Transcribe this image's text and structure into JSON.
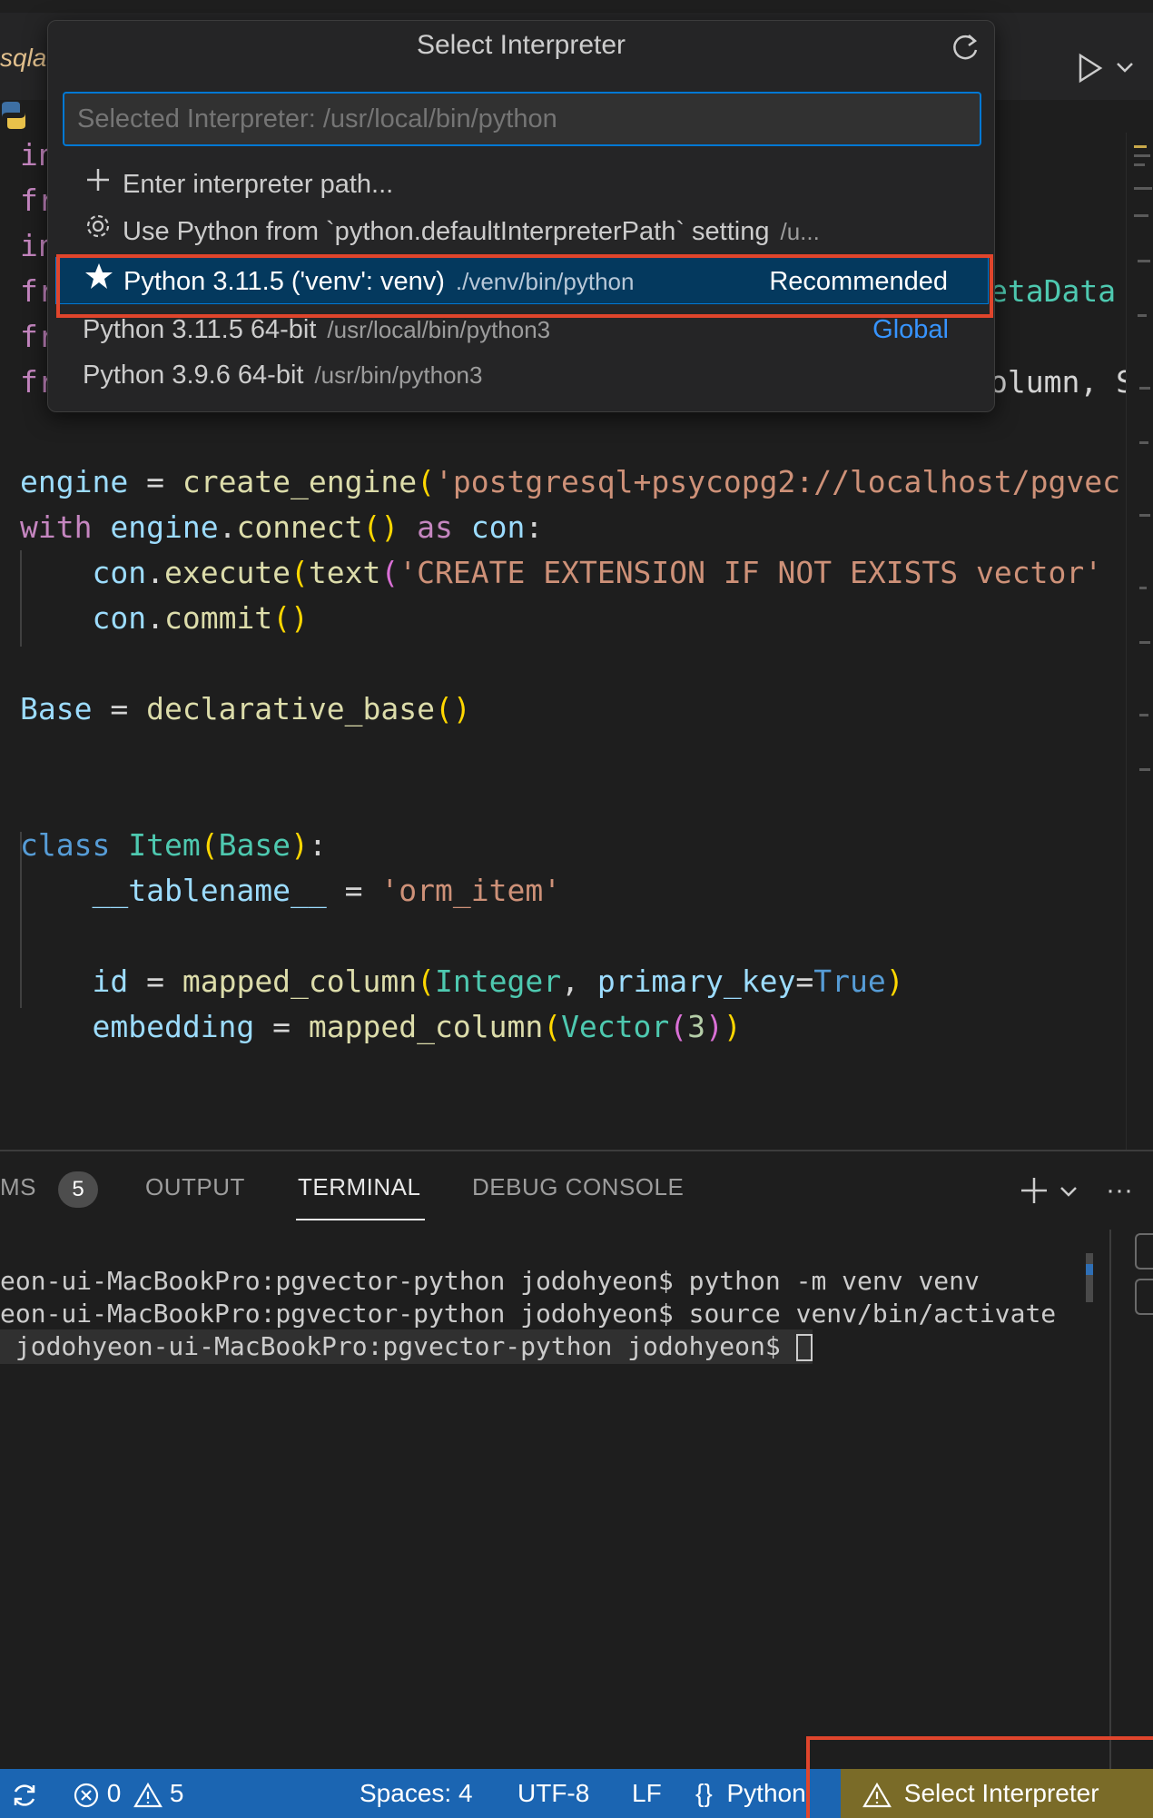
{
  "editor_tab": {
    "file_label": "sqla"
  },
  "quick_pick": {
    "title": "Select Interpreter",
    "placeholder": "Selected Interpreter: /usr/local/bin/python",
    "items": [
      {
        "icon": "plus-icon",
        "label": "Enter interpreter path...",
        "description": "",
        "tag": ""
      },
      {
        "icon": "gear-icon",
        "label": "Use Python from `python.defaultInterpreterPath` setting",
        "description": "/u...",
        "tag": ""
      },
      {
        "icon": "star-icon",
        "label": "Python 3.11.5 ('venv': venv)",
        "description": "./venv/bin/python",
        "tag": "Recommended",
        "selected": true
      },
      {
        "icon": "",
        "label": "Python 3.11.5 64-bit",
        "description": "/usr/local/bin/python3",
        "tag": "Global"
      },
      {
        "icon": "",
        "label": "Python 3.9.6 64-bit",
        "description": "/usr/bin/python3",
        "tag": ""
      }
    ]
  },
  "code": {
    "hidden_prefixes": [
      "in",
      "fr",
      "in",
      "fr",
      "fr",
      "fr"
    ],
    "peeking_right": [
      "etaData",
      "olumn, S"
    ],
    "line8": {
      "a": "engine",
      "b": " = ",
      "c": "create_engine",
      "d": "(",
      "e": "'postgresql+psycopg2://localhost/pgvec"
    },
    "line9": {
      "a": "with",
      "b": " ",
      "c": "engine",
      "d": ".",
      "e": "connect",
      "f": "()",
      "g": " ",
      "h": "as",
      "i": " ",
      "j": "con",
      "k": ":"
    },
    "line10": {
      "a": "    ",
      "b": "con",
      "c": ".",
      "d": "execute",
      "e": "(",
      "f": "text",
      "g": "(",
      "h": "'CREATE EXTENSION IF NOT EXISTS vector'"
    },
    "line11": {
      "a": "    ",
      "b": "con",
      "c": ".",
      "d": "commit",
      "e": "()"
    },
    "line13": {
      "a": "Base",
      "b": " = ",
      "c": "declarative_base",
      "d": "()"
    },
    "line16": {
      "a": "class",
      "b": " ",
      "c": "Item",
      "d": "(",
      "e": "Base",
      "f": ")",
      "g": ":"
    },
    "line17": {
      "a": "    ",
      "b": "__tablename__",
      "c": " = ",
      "d": "'orm_item'"
    },
    "line19": {
      "a": "    ",
      "b": "id",
      "c": " = ",
      "d": "mapped_column",
      "e": "(",
      "f": "Integer",
      "g": ", ",
      "h": "primary_key",
      "i": "=",
      "j": "True",
      "k": ")"
    },
    "line20": {
      "a": "    ",
      "b": "embedding",
      "c": " = ",
      "d": "mapped_column",
      "e": "(",
      "f": "Vector",
      "g": "(",
      "h": "3",
      "i": ")",
      "j": ")"
    }
  },
  "panel": {
    "tabs": {
      "problems": "MS",
      "problems_count": "5",
      "output": "OUTPUT",
      "terminal": "TERMINAL",
      "debug": "DEBUG CONSOLE"
    },
    "more": "···",
    "terminal_lines": [
      "eon-ui-MacBookPro:pgvector-python jodohyeon$ python -m venv venv",
      "eon-ui-MacBookPro:pgvector-python jodohyeon$ source venv/bin/activate",
      " jodohyeon-ui-MacBookPro:pgvector-python jodohyeon$ "
    ]
  },
  "status_bar": {
    "errors": "0",
    "warnings": "5",
    "spaces": "Spaces: 4",
    "encoding": "UTF-8",
    "eol": "LF",
    "language": "Python",
    "interpreter": "Select Interpreter"
  },
  "colors": {
    "accent": "#0078d4",
    "status_bar": "#1b65b2",
    "warning_item": "#7a6b28",
    "highlight_annotation": "#e0452c",
    "selected_item": "#04395e"
  }
}
